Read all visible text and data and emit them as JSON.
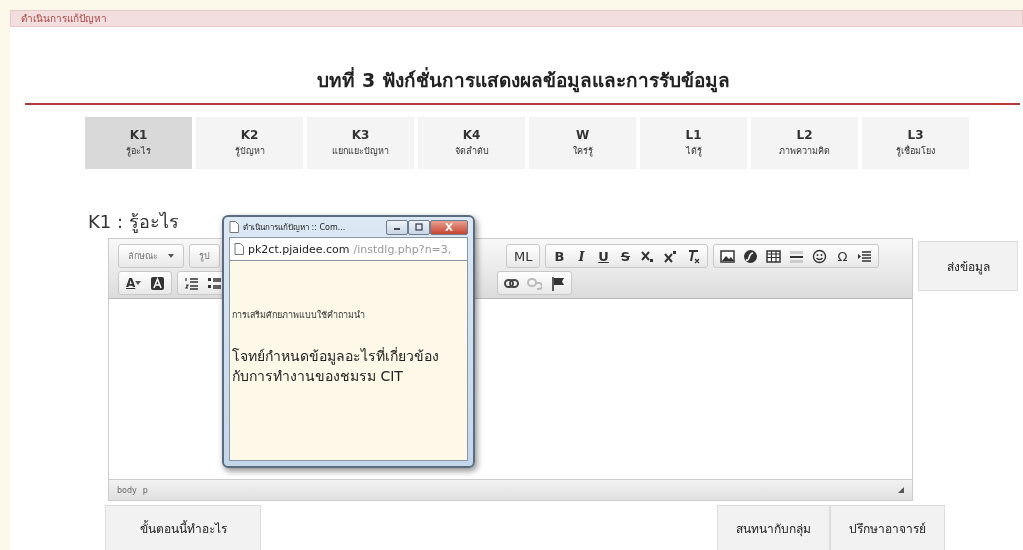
{
  "header": {
    "title": "ดำเนินการแก้ปัญหา"
  },
  "page_title": "บทที่ 3 ฟังก์ชั่นการแสดงผลข้อมูลและการรับข้อมูล",
  "tabs": [
    {
      "code": "K1",
      "label": "รู้อะไร",
      "selected": true
    },
    {
      "code": "K2",
      "label": "รู้ปัญหา",
      "selected": false
    },
    {
      "code": "K3",
      "label": "แยกแยะปัญหา",
      "selected": false
    },
    {
      "code": "K4",
      "label": "จัดลำดับ",
      "selected": false
    },
    {
      "code": "W",
      "label": "ใคร่รู้",
      "selected": false
    },
    {
      "code": "L1",
      "label": "ได้รู้",
      "selected": false
    },
    {
      "code": "L2",
      "label": "ภาพความคิด",
      "selected": false
    },
    {
      "code": "L3",
      "label": "รู้เชื่อมโยง",
      "selected": false
    }
  ],
  "section_heading": "K1 : รู้อะไร",
  "toolbar": {
    "row_1_left": [
      [
        {
          "kind": "dropdown",
          "label": "ลักษณะ"
        }
      ],
      [
        {
          "kind": "dropdown-cut",
          "label": "รูป"
        }
      ]
    ],
    "row_1_right": [
      [
        {
          "kind": "source",
          "label": "ML"
        }
      ],
      [
        {
          "kind": "bold",
          "label": "B"
        },
        {
          "kind": "italic",
          "label": "I"
        },
        {
          "kind": "underline",
          "label": "U"
        },
        {
          "kind": "strike",
          "label": "S"
        },
        {
          "kind": "subscript"
        },
        {
          "kind": "superscript"
        },
        {
          "kind": "remove-format"
        }
      ],
      [
        {
          "kind": "image"
        },
        {
          "kind": "flash"
        },
        {
          "kind": "table"
        },
        {
          "kind": "horizontal-line"
        },
        {
          "kind": "smiley"
        },
        {
          "kind": "special-char",
          "label": "Ω"
        },
        {
          "kind": "page-break"
        }
      ]
    ],
    "row_2_left": [
      [
        {
          "kind": "text-color",
          "label": "A"
        },
        {
          "kind": "bg-color"
        }
      ],
      [
        {
          "kind": "numbered-list"
        },
        {
          "kind": "bullet-list"
        }
      ]
    ],
    "row_2_right": [
      [
        {
          "kind": "link"
        },
        {
          "kind": "unlink"
        },
        {
          "kind": "anchor"
        }
      ]
    ]
  },
  "status_bar": [
    "body",
    "p"
  ],
  "submit_button": "ส่งข้อมูล",
  "bottom_buttons": {
    "left": [
      "ขั้นตอนนี้ทำอะไร"
    ],
    "right": [
      "สนทนากับกลุ่ม",
      "ปรึกษาอาจารย์"
    ]
  },
  "popup": {
    "title": "ดำเนินการแก้ปัญหา :: Com...",
    "url_host": "pk2ct.pjaidee.com",
    "url_path": "/instdlg.php?n=3,",
    "subtitle": "การเสริมศักยภาพแบบใช้คำถามนำ",
    "question": "โจทย์กำหนดข้อมูลอะไรที่เกี่ยวข้องกับการทำงานของชมรม CIT"
  }
}
